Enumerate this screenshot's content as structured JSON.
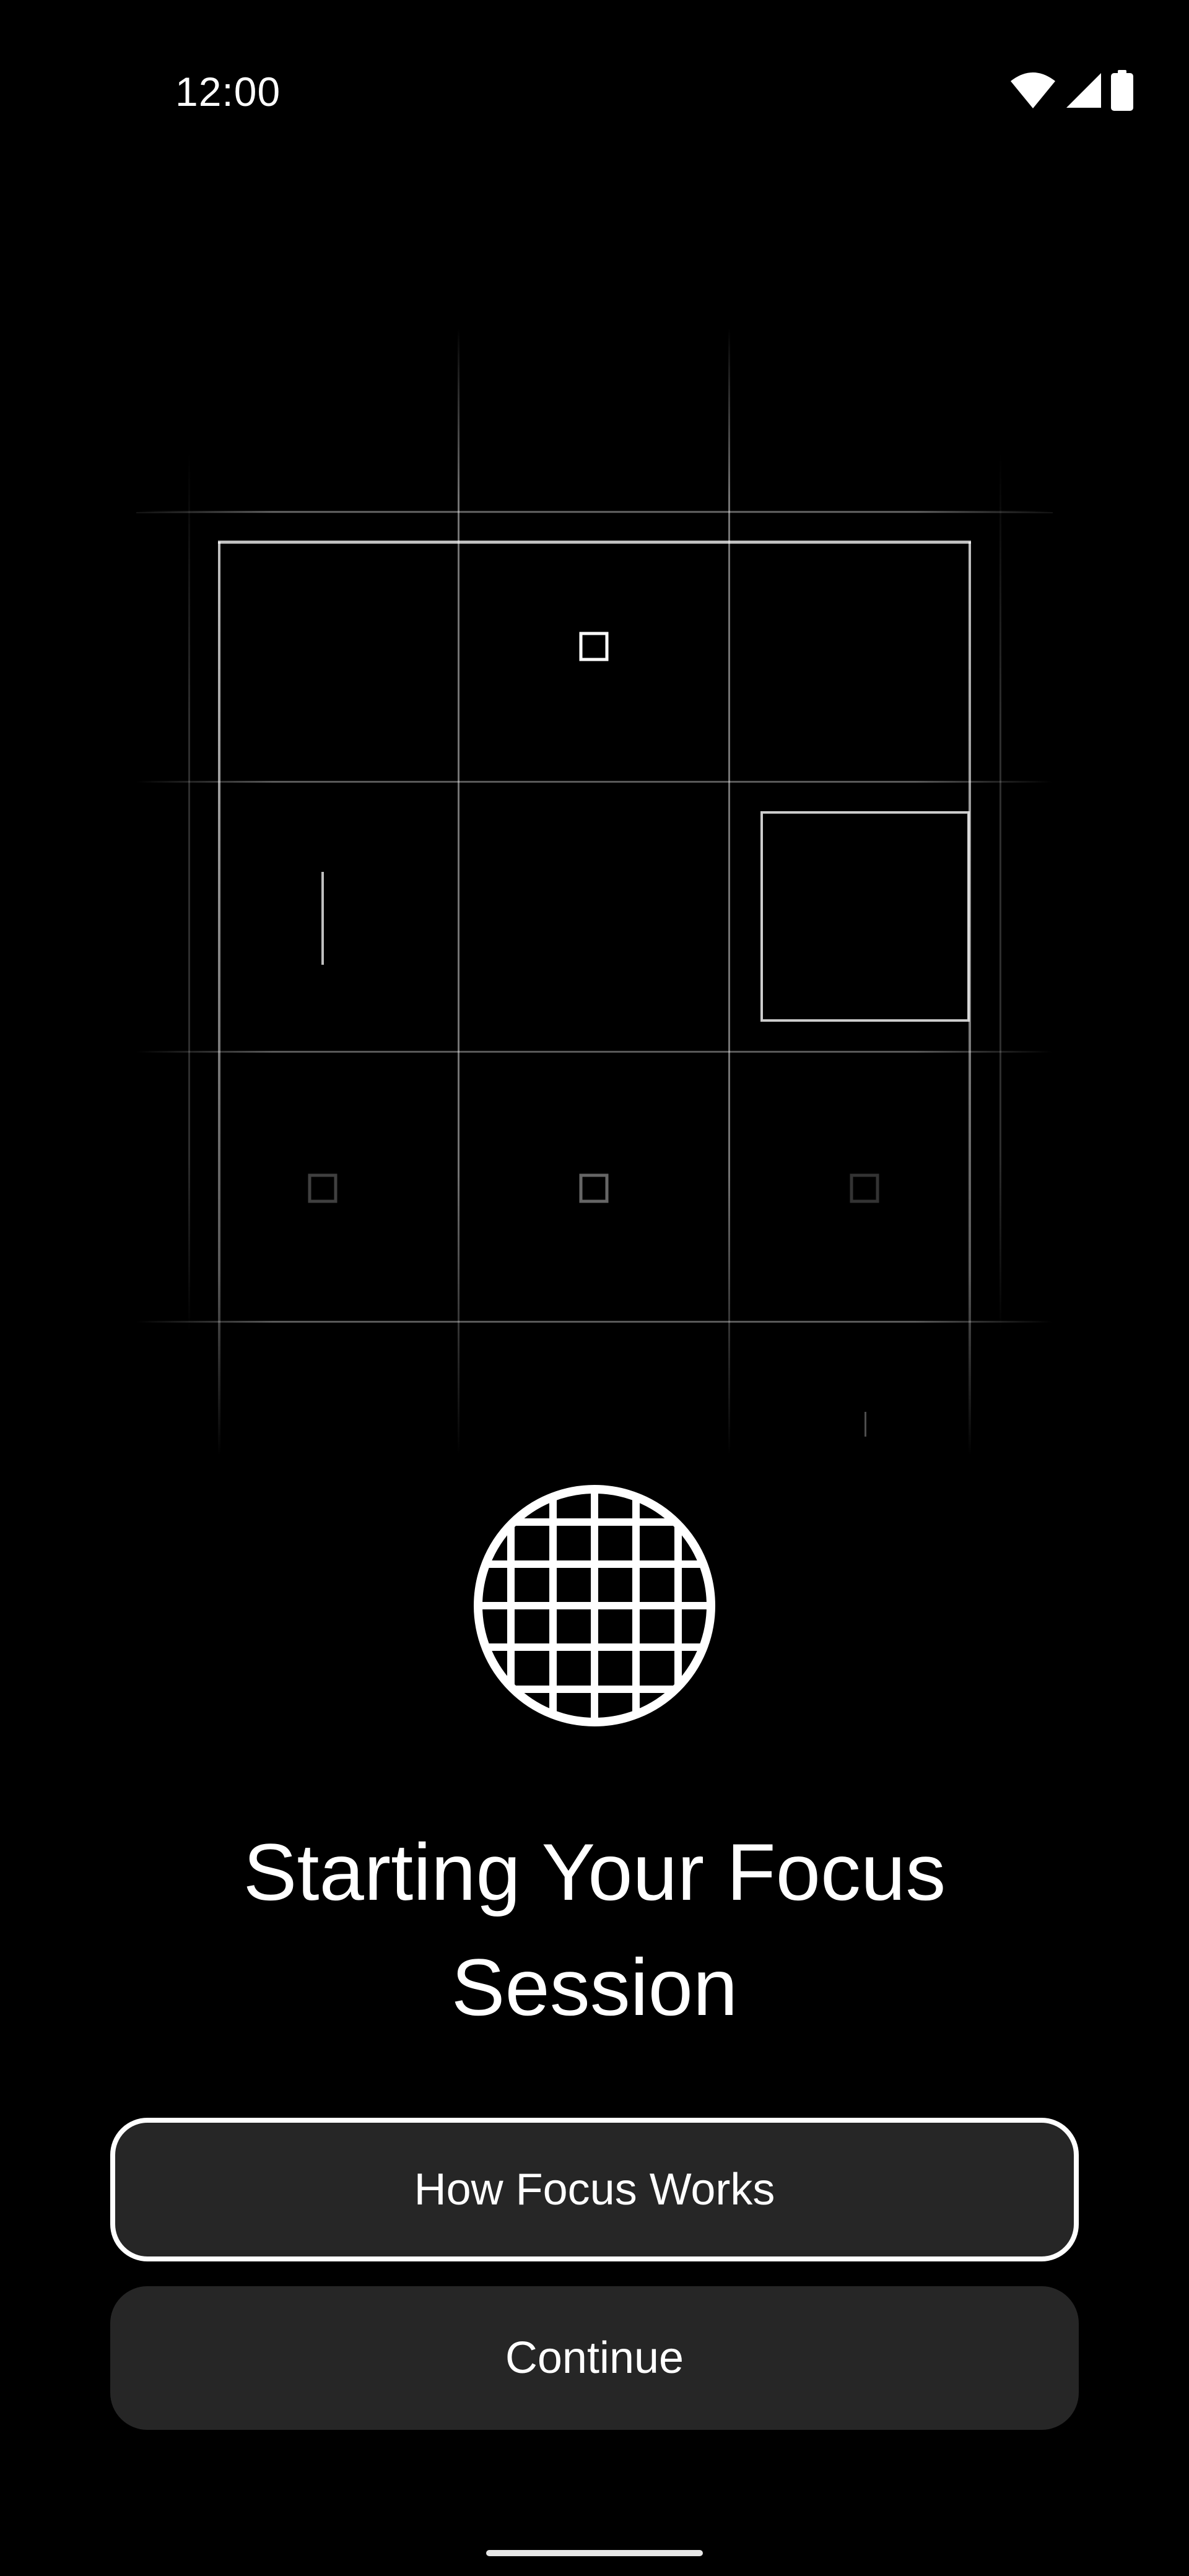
{
  "status_bar": {
    "time": "12:00",
    "icons": [
      "wifi-icon",
      "cellular-signal-icon",
      "battery-icon"
    ]
  },
  "illustration": {
    "name": "focus-grid-illustration",
    "stroke_color": "#ffffff"
  },
  "emblem": {
    "icon": "grid-globe-icon"
  },
  "title": {
    "line1": "Starting Your Focus",
    "line2": "Session"
  },
  "buttons": {
    "how_label": "How Focus Works",
    "continue_label": "Continue"
  },
  "colors": {
    "background": "#000000",
    "button_fill": "#262626",
    "text": "#ffffff"
  }
}
